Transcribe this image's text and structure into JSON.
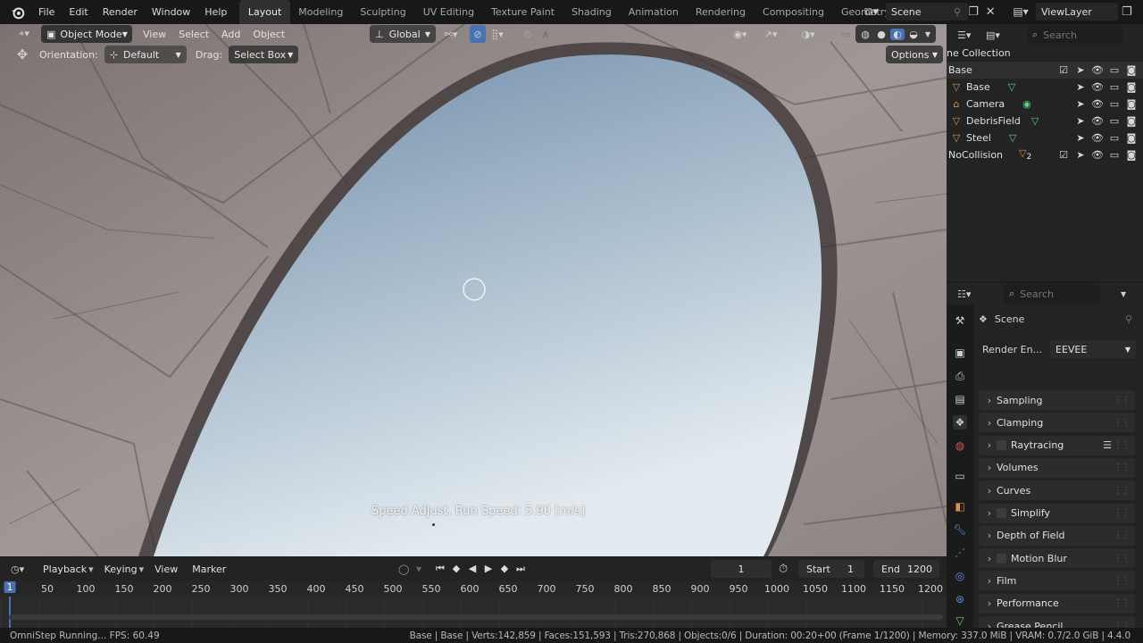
{
  "topbar": {
    "menus": [
      "File",
      "Edit",
      "Render",
      "Window",
      "Help"
    ],
    "workspace_tabs": [
      "Layout",
      "Modeling",
      "Sculpting",
      "UV Editing",
      "Texture Paint",
      "Shading",
      "Animation",
      "Rendering",
      "Compositing",
      "Geometry Node"
    ],
    "active_tab": "Layout",
    "scene_name": "Scene",
    "view_layer": "ViewLayer"
  },
  "viewport_header": {
    "mode": "Object Mode",
    "menus": [
      "View",
      "Select",
      "Add",
      "Object"
    ],
    "transform_orientation": "Global"
  },
  "tool_header": {
    "orientation_label": "Orientation:",
    "orientation_value": "Default",
    "drag_label": "Drag:",
    "drag_value": "Select Box",
    "options_label": "Options"
  },
  "viewport": {
    "overlay_text": "Speed Adjust, Run Speed: 5.90 [m/s]"
  },
  "outliner": {
    "search_placeholder": "Search",
    "collection_label": "ne Collection",
    "items": [
      {
        "name": "Base",
        "type": "collection"
      },
      {
        "name": "Base",
        "type": "mesh"
      },
      {
        "name": "Camera",
        "type": "camera"
      },
      {
        "name": "DebrisField",
        "type": "mesh"
      },
      {
        "name": "Steel",
        "type": "mesh"
      },
      {
        "name": "NoCollision",
        "type": "collection",
        "badge": "2"
      }
    ]
  },
  "properties": {
    "search_placeholder": "Search",
    "context": "Scene",
    "render_engine_label": "Render En...",
    "render_engine_value": "EEVEE",
    "panels": [
      {
        "label": "Sampling",
        "checkbox": false
      },
      {
        "label": "Clamping",
        "checkbox": false
      },
      {
        "label": "Raytracing",
        "checkbox": true
      },
      {
        "label": "Volumes",
        "checkbox": false
      },
      {
        "label": "Curves",
        "checkbox": false
      },
      {
        "label": "Simplify",
        "checkbox": true
      },
      {
        "label": "Depth of Field",
        "checkbox": false
      },
      {
        "label": "Motion Blur",
        "checkbox": true
      },
      {
        "label": "Film",
        "checkbox": false
      },
      {
        "label": "Performance",
        "checkbox": false
      },
      {
        "label": "Grease Pencil",
        "checkbox": false
      }
    ]
  },
  "timeline": {
    "menus": [
      "Playback",
      "Keying",
      "View",
      "Marker"
    ],
    "current_frame": "1",
    "start_label": "Start",
    "start_value": "1",
    "end_label": "End",
    "end_value": "1200",
    "ruler_ticks": [
      "1",
      "50",
      "100",
      "150",
      "200",
      "250",
      "300",
      "350",
      "400",
      "450",
      "500",
      "550",
      "600",
      "650",
      "700",
      "750",
      "800",
      "850",
      "900",
      "950",
      "1000",
      "1050",
      "1100",
      "1150",
      "1200"
    ]
  },
  "statusbar": {
    "left": "OmniStep Running... FPS: 60.49",
    "right": "Base | Base | Verts:142,859 | Faces:151,593 | Tris:270,868 | Objects:0/6 | Duration: 00:20+00 (Frame 1/1200) | Memory: 337.0 MiB | VRAM: 0.7/2.0 GiB | 4.4.0"
  },
  "colors": {
    "accent": "#4772b3",
    "sky_top": "#7e9ab3",
    "sky_bottom": "#dfe6ec",
    "concrete": "#8d8988",
    "mesh_icon": "#e09040",
    "data_icon": "#5bd17a"
  }
}
